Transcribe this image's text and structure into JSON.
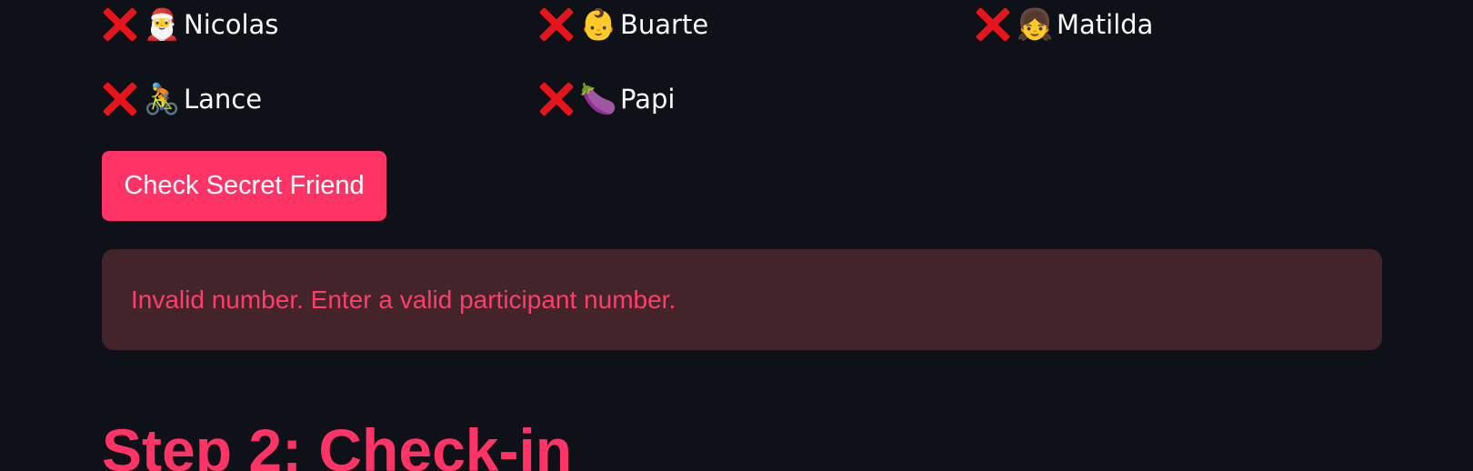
{
  "participants": [
    {
      "status_icon": "red-x-icon",
      "emoji": "🎅",
      "name": "Nicolas"
    },
    {
      "status_icon": "red-x-icon",
      "emoji": "👶",
      "name": "Buarte"
    },
    {
      "status_icon": "red-x-icon",
      "emoji": "👧",
      "name": "Matilda"
    },
    {
      "status_icon": "red-x-icon",
      "emoji": "🚴",
      "name": "Lance"
    },
    {
      "status_icon": "red-x-icon",
      "emoji": "🍆",
      "name": "Papi"
    }
  ],
  "check_button": {
    "label": "Check Secret Friend"
  },
  "alert": {
    "message": "Invalid number. Enter a valid participant number."
  },
  "step2": {
    "heading": "Step 2: Check-in"
  },
  "colors": {
    "background": "#0e1117",
    "accent": "#ff3366",
    "error_bg": "#42242a",
    "error_text": "#ff3d6b",
    "x_mark": "#e8141b"
  }
}
